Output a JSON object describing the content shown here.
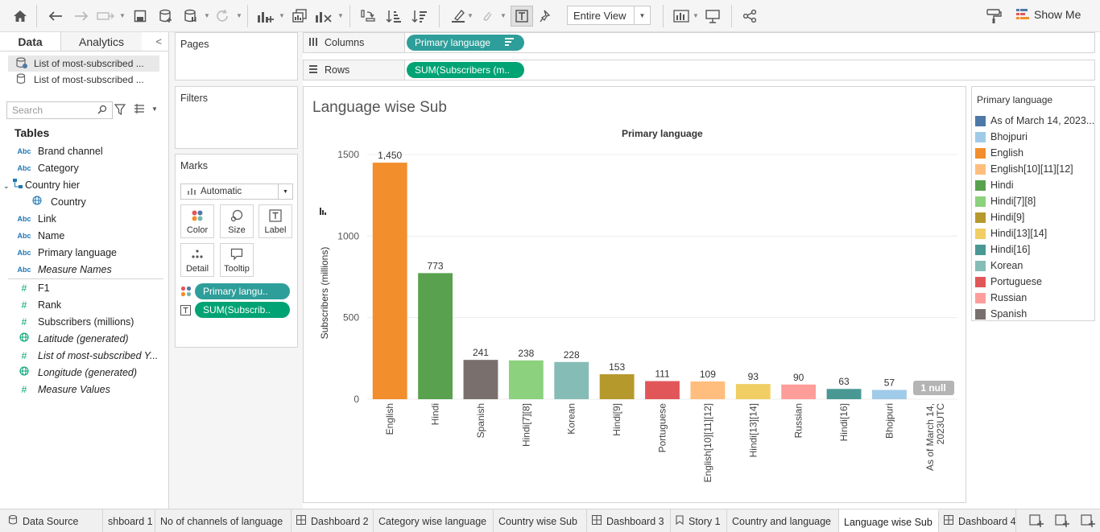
{
  "toolbar": {
    "entire_view": "Entire View",
    "show_me": "Show Me"
  },
  "data_pane": {
    "tab_data": "Data",
    "tab_analytics": "Analytics",
    "datasources": [
      "List of most-subscribed ...",
      "List of most-subscribed ..."
    ],
    "search_placeholder": "Search",
    "tables_heading": "Tables",
    "fields": [
      {
        "icon": "Abc",
        "name": "Brand channel",
        "kind": "dim"
      },
      {
        "icon": "Abc",
        "name": "Category",
        "kind": "dim"
      },
      {
        "icon": "hier",
        "name": "Country hier",
        "kind": "hier"
      },
      {
        "icon": "geo",
        "name": "Country",
        "kind": "geo-child"
      },
      {
        "icon": "Abc",
        "name": "Link",
        "kind": "dim"
      },
      {
        "icon": "Abc",
        "name": "Name",
        "kind": "dim"
      },
      {
        "icon": "Abc",
        "name": "Primary language",
        "kind": "dim"
      },
      {
        "icon": "Abc",
        "name": "Measure Names",
        "kind": "dim-italic"
      },
      {
        "icon": "#",
        "name": "F1",
        "kind": "measure"
      },
      {
        "icon": "#",
        "name": "Rank",
        "kind": "measure"
      },
      {
        "icon": "#",
        "name": "Subscribers (millions)",
        "kind": "measure"
      },
      {
        "icon": "geo",
        "name": "Latitude (generated)",
        "kind": "geo-italic"
      },
      {
        "icon": "#",
        "name": "List of most-subscribed Y...",
        "kind": "measure-italic"
      },
      {
        "icon": "geo",
        "name": "Longitude (generated)",
        "kind": "geo-italic"
      },
      {
        "icon": "#",
        "name": "Measure Values",
        "kind": "measure-italic"
      }
    ]
  },
  "shelves": {
    "pages": "Pages",
    "filters": "Filters",
    "marks": "Marks",
    "marks_type": "Automatic",
    "mark_buttons": [
      "Color",
      "Size",
      "Label",
      "Detail",
      "Tooltip"
    ],
    "mark_pills": [
      "Primary langu..",
      "SUM(Subscrib.."
    ],
    "columns_label": "Columns",
    "rows_label": "Rows",
    "columns_pill": "Primary language",
    "rows_pill": "SUM(Subscribers (m.."
  },
  "viz": {
    "title": "Language wise Sub",
    "top_header": "Primary language",
    "null_badge": "1 null"
  },
  "legend": {
    "title": "Primary language",
    "items": [
      {
        "label": "As of March 14, 2023...",
        "color": "#4e79a7"
      },
      {
        "label": "Bhojpuri",
        "color": "#a0cbe8"
      },
      {
        "label": "English",
        "color": "#f28e2b"
      },
      {
        "label": "English[10][11][12]",
        "color": "#ffbe7d"
      },
      {
        "label": "Hindi",
        "color": "#59a14f"
      },
      {
        "label": "Hindi[7][8]",
        "color": "#8cd17d"
      },
      {
        "label": "Hindi[9]",
        "color": "#b6992d"
      },
      {
        "label": "Hindi[13][14]",
        "color": "#f1ce63"
      },
      {
        "label": "Hindi[16]",
        "color": "#499894"
      },
      {
        "label": "Korean",
        "color": "#86bcb6"
      },
      {
        "label": "Portuguese",
        "color": "#e15759"
      },
      {
        "label": "Russian",
        "color": "#ff9d9a"
      },
      {
        "label": "Spanish",
        "color": "#79706e"
      }
    ]
  },
  "chart_data": {
    "type": "bar",
    "title": "Language wise Sub",
    "xlabel": "Primary language",
    "ylabel": "Subscribers (millions)",
    "ylim": [
      0,
      1500
    ],
    "yticks": [
      0,
      500,
      1000,
      1500
    ],
    "grid": true,
    "categories": [
      "English",
      "Hindi",
      "Spanish",
      "Hindi[7][8]",
      "Korean",
      "Hindi[9]",
      "Portuguese",
      "English[10][11][12]",
      "Hindi[13][14]",
      "Russian",
      "Hindi[16]",
      "Bhojpuri",
      "As of March 14, 2023UTC"
    ],
    "values": [
      1450,
      773,
      241,
      238,
      228,
      153,
      111,
      109,
      93,
      90,
      63,
      57,
      null
    ],
    "value_labels": [
      "1,450",
      "773",
      "241",
      "238",
      "228",
      "153",
      "111",
      "109",
      "93",
      "90",
      "63",
      "57",
      ""
    ],
    "colors": [
      "#f28e2b",
      "#59a14f",
      "#79706e",
      "#8cd17d",
      "#86bcb6",
      "#b6992d",
      "#e15759",
      "#ffbe7d",
      "#f1ce63",
      "#ff9d9a",
      "#499894",
      "#a0cbe8",
      "#4e79a7"
    ]
  },
  "bottom_tabs": [
    {
      "label": "Data Source",
      "icon": "db"
    },
    {
      "label": "shboard 1",
      "icon": ""
    },
    {
      "label": "No of channels of language",
      "icon": ""
    },
    {
      "label": "Dashboard 2",
      "icon": "dash"
    },
    {
      "label": "Category wise language",
      "icon": ""
    },
    {
      "label": "Country wise Sub",
      "icon": ""
    },
    {
      "label": "Dashboard 3",
      "icon": "dash"
    },
    {
      "label": "Story 1",
      "icon": "story"
    },
    {
      "label": "Country and language",
      "icon": ""
    },
    {
      "label": "Language wise Sub",
      "icon": ""
    },
    {
      "label": "Dashboard 4",
      "icon": "dash"
    }
  ]
}
